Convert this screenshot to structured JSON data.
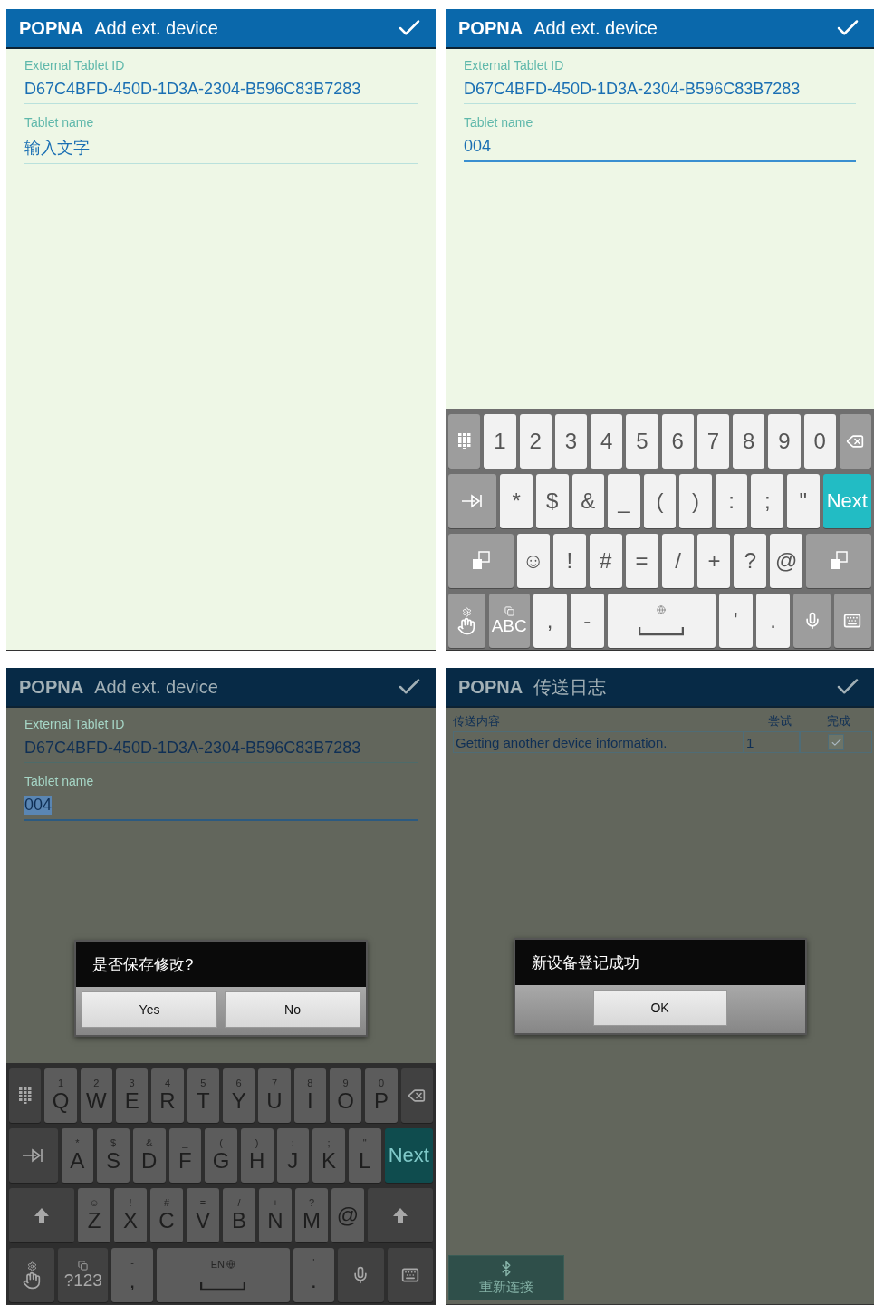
{
  "panels": [
    {
      "kind": "form",
      "dimmed": false,
      "header": {
        "brand": "POPNA",
        "title": "Add ext. device"
      },
      "fields": [
        {
          "label": "External Tablet ID",
          "value": "D67C4BFD-450D-1D3A-2304-B596C83B7283",
          "focused": false,
          "highlighted": false
        },
        {
          "label": "Tablet name",
          "value": "输入文字",
          "focused": false,
          "highlighted": false
        }
      ]
    },
    {
      "kind": "form",
      "dimmed": false,
      "header": {
        "brand": "POPNA",
        "title": "Add ext. device"
      },
      "fields": [
        {
          "label": "External Tablet ID",
          "value": "D67C4BFD-450D-1D3A-2304-B596C83B7283",
          "focused": false,
          "highlighted": false
        },
        {
          "label": "Tablet name",
          "value": "004",
          "focused": true,
          "highlighted": false
        }
      ],
      "keyboard": {
        "rows": [
          {
            "keys": [
              {
                "kind": "grid"
              },
              {
                "kind": "char",
                "label": "1"
              },
              {
                "kind": "char",
                "label": "2"
              },
              {
                "kind": "char",
                "label": "3"
              },
              {
                "kind": "char",
                "label": "4"
              },
              {
                "kind": "char",
                "label": "5"
              },
              {
                "kind": "char",
                "label": "6"
              },
              {
                "kind": "char",
                "label": "7"
              },
              {
                "kind": "char",
                "label": "8"
              },
              {
                "kind": "char",
                "label": "9"
              },
              {
                "kind": "char",
                "label": "0"
              },
              {
                "kind": "backspace"
              }
            ]
          },
          {
            "keys": [
              {
                "kind": "tab"
              },
              {
                "kind": "char",
                "label": "*"
              },
              {
                "kind": "char",
                "label": "$"
              },
              {
                "kind": "char",
                "label": "&"
              },
              {
                "kind": "char",
                "label": "_"
              },
              {
                "kind": "char",
                "label": "("
              },
              {
                "kind": "char",
                "label": ")"
              },
              {
                "kind": "char",
                "label": ":"
              },
              {
                "kind": "char",
                "label": ";"
              },
              {
                "kind": "char",
                "label": "\""
              },
              {
                "kind": "action",
                "label": "Next"
              }
            ]
          },
          {
            "keys": [
              {
                "kind": "layout"
              },
              {
                "kind": "char",
                "label": "☺"
              },
              {
                "kind": "char",
                "label": "!"
              },
              {
                "kind": "char",
                "label": "#"
              },
              {
                "kind": "char",
                "label": "="
              },
              {
                "kind": "char",
                "label": "/"
              },
              {
                "kind": "char",
                "label": "+"
              },
              {
                "kind": "char",
                "label": "?"
              },
              {
                "kind": "char",
                "label": "@"
              },
              {
                "kind": "layout"
              }
            ]
          },
          {
            "keys": [
              {
                "kind": "handwriting"
              },
              {
                "kind": "mode",
                "label": "ABC"
              },
              {
                "kind": "char",
                "label": ","
              },
              {
                "kind": "char",
                "label": "-"
              },
              {
                "kind": "space"
              },
              {
                "kind": "char",
                "label": "'"
              },
              {
                "kind": "char",
                "label": "."
              },
              {
                "kind": "mic"
              },
              {
                "kind": "keyboard"
              }
            ]
          }
        ]
      }
    },
    {
      "kind": "form",
      "dimmed": true,
      "header": {
        "brand": "POPNA",
        "title": "Add ext. device"
      },
      "fields": [
        {
          "label": "External Tablet ID",
          "value": "D67C4BFD-450D-1D3A-2304-B596C83B7283",
          "focused": false,
          "highlighted": false
        },
        {
          "label": "Tablet name",
          "value": "004",
          "focused": true,
          "highlighted": true
        }
      ],
      "dialog": {
        "message": "是否保存修改?",
        "buttons": [
          "Yes",
          "No"
        ]
      },
      "keyboard": {
        "rows": [
          {
            "keys": [
              {
                "kind": "grid"
              },
              {
                "kind": "char",
                "label": "Q",
                "hint": "1"
              },
              {
                "kind": "char",
                "label": "W",
                "hint": "2"
              },
              {
                "kind": "char",
                "label": "E",
                "hint": "3"
              },
              {
                "kind": "char",
                "label": "R",
                "hint": "4"
              },
              {
                "kind": "char",
                "label": "T",
                "hint": "5"
              },
              {
                "kind": "char",
                "label": "Y",
                "hint": "6"
              },
              {
                "kind": "char",
                "label": "U",
                "hint": "7"
              },
              {
                "kind": "char",
                "label": "I",
                "hint": "8"
              },
              {
                "kind": "char",
                "label": "O",
                "hint": "9"
              },
              {
                "kind": "char",
                "label": "P",
                "hint": "0"
              },
              {
                "kind": "backspace"
              }
            ]
          },
          {
            "keys": [
              {
                "kind": "tab"
              },
              {
                "kind": "char",
                "label": "A",
                "hint": "*"
              },
              {
                "kind": "char",
                "label": "S",
                "hint": "$"
              },
              {
                "kind": "char",
                "label": "D",
                "hint": "&"
              },
              {
                "kind": "char",
                "label": "F",
                "hint": "_"
              },
              {
                "kind": "char",
                "label": "G",
                "hint": "("
              },
              {
                "kind": "char",
                "label": "H",
                "hint": ")"
              },
              {
                "kind": "char",
                "label": "J",
                "hint": ":"
              },
              {
                "kind": "char",
                "label": "K",
                "hint": ";"
              },
              {
                "kind": "char",
                "label": "L",
                "hint": "\""
              },
              {
                "kind": "action",
                "label": "Next"
              }
            ]
          },
          {
            "keys": [
              {
                "kind": "shift"
              },
              {
                "kind": "char",
                "label": "Z",
                "hint": "☺"
              },
              {
                "kind": "char",
                "label": "X",
                "hint": "!"
              },
              {
                "kind": "char",
                "label": "C",
                "hint": "#"
              },
              {
                "kind": "char",
                "label": "V",
                "hint": "="
              },
              {
                "kind": "char",
                "label": "B",
                "hint": "/"
              },
              {
                "kind": "char",
                "label": "N",
                "hint": "+"
              },
              {
                "kind": "char",
                "label": "M",
                "hint": "?"
              },
              {
                "kind": "char",
                "label": "@"
              },
              {
                "kind": "shift"
              }
            ]
          },
          {
            "keys": [
              {
                "kind": "handwriting"
              },
              {
                "kind": "mode",
                "label": "?123"
              },
              {
                "kind": "char",
                "label": ",",
                "hint": "-"
              },
              {
                "kind": "space",
                "hint": "EN"
              },
              {
                "kind": "char",
                "label": ".",
                "hint": "'"
              },
              {
                "kind": "mic"
              },
              {
                "kind": "keyboard"
              }
            ]
          }
        ]
      }
    },
    {
      "kind": "log",
      "dimmed": true,
      "header": {
        "brand": "POPNA",
        "title": "传送日志"
      },
      "table": {
        "columns": [
          "传送内容",
          "尝试",
          "完成"
        ],
        "rows": [
          {
            "content": "Getting another device information.",
            "attempts": "1",
            "done": true
          }
        ]
      },
      "dialog": {
        "message": "新设备登记成功",
        "buttons": [
          "OK"
        ]
      },
      "reconnect_button": {
        "label": "重新连接"
      }
    }
  ]
}
